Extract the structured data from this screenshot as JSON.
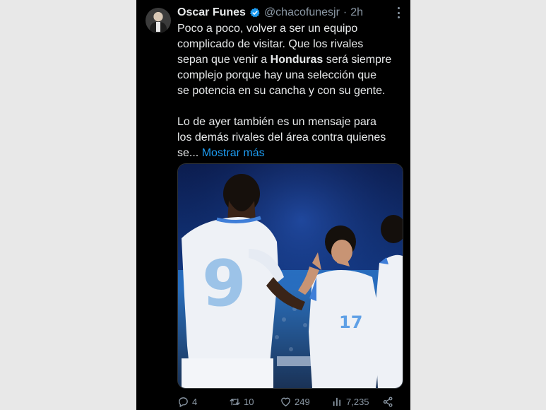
{
  "tweet": {
    "author_name": "Oscar Funes",
    "handle": "@chacofunesjr",
    "separator": "·",
    "time": "2h",
    "paragraph1_line1": "Poco a poco, volver a ser un equipo",
    "paragraph1_line2": "complicado de visitar. Que los rivales",
    "paragraph1_line3a": "sepan que venir a ",
    "paragraph1_bold": "Honduras",
    "paragraph1_line3b": " será siempre",
    "paragraph1_line4": "complejo porque hay una selección que",
    "paragraph1_line5": "se potencia en su cancha y con su gente.",
    "paragraph2_line1": "Lo de ayer también es un mensaje para",
    "paragraph2_line2": "los demás rivales del área contra quienes",
    "paragraph2_line3": "se... ",
    "show_more": "Mostrar más"
  },
  "actions": {
    "replies": "4",
    "retweets": "10",
    "likes": "249",
    "views": "7,235"
  },
  "photo": {
    "jersey_number_left": "9",
    "jersey_number_right": "17"
  },
  "colors": {
    "background": "#000000",
    "text": "#e7e9ea",
    "muted": "#8b98a5",
    "accent": "#1d9bf0"
  },
  "icons": [
    "verified-badge-icon",
    "more-options-icon",
    "reply-icon",
    "retweet-icon",
    "like-icon",
    "views-icon",
    "share-icon"
  ]
}
